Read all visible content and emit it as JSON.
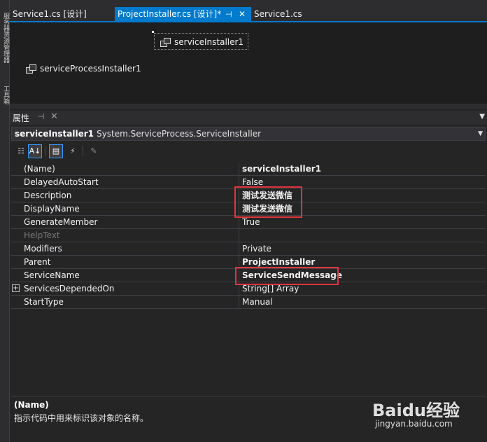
{
  "sidebar": {
    "tab_one": "服务器资源管理器",
    "tab_two": "工具箱"
  },
  "tabs": [
    {
      "label": "Service1.cs [设计]",
      "active": false
    },
    {
      "label": "ProjectInstaller.cs [设计]*",
      "active": true
    },
    {
      "label": "Service1.cs",
      "active": false
    }
  ],
  "designer": {
    "components": [
      "serviceInstaller1",
      "serviceProcessInstaller1"
    ]
  },
  "properties": {
    "title": "属性",
    "object_name": "serviceInstaller1",
    "object_type": "System.ServiceProcess.ServiceInstaller",
    "rows": [
      {
        "name": "(Name)",
        "value": "serviceInstaller1"
      },
      {
        "name": "DelayedAutoStart",
        "value": "False"
      },
      {
        "name": "Description",
        "value": "测试发送微信"
      },
      {
        "name": "DisplayName",
        "value": "测试发送微信"
      },
      {
        "name": "GenerateMember",
        "value": "True"
      },
      {
        "name": "HelpText",
        "value": ""
      },
      {
        "name": "Modifiers",
        "value": "Private"
      },
      {
        "name": "Parent",
        "value": "ProjectInstaller"
      },
      {
        "name": "ServiceName",
        "value": "ServiceSendMessage"
      },
      {
        "name": "ServicesDependedOn",
        "value": "String[] Array"
      },
      {
        "name": "StartType",
        "value": "Manual"
      }
    ],
    "description_title": "(Name)",
    "description_text": "指示代码中用来标识该对象的名称。"
  },
  "watermark": {
    "logo": "Baidu经验",
    "url": "jingyan.baidu.com"
  },
  "colors": {
    "accent": "#007acc",
    "highlight": "#e0363a"
  }
}
